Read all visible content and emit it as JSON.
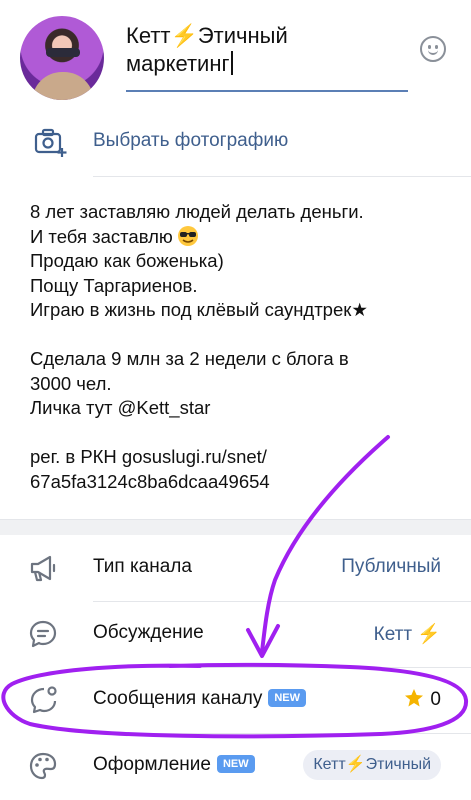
{
  "profile": {
    "name_line1": "Кетт⚡Этичный",
    "name_line2": "маркетинг",
    "emoji_icon": "smiley-icon"
  },
  "photo": {
    "label": "Выбрать фотографию",
    "icon": "camera-add-icon"
  },
  "bio": {
    "lines": [
      "8 лет заставляю людей делать деньги.",
      "И тебя заставлю",
      "Продаю как боженька)",
      "Пощу Таргариенов.",
      "Играю в жизнь под клёвый саундтрек★",
      "",
      "Сделала 9 млн за 2 недели с блога в",
      "3000 чел.",
      "Личка тут @Kett_star",
      "",
      "рег. в РКН gosuslugi.ru/snet/",
      "67a5fa3124c8ba6dcaa49654"
    ]
  },
  "settings": {
    "channel_type": {
      "label": "Тип канала",
      "value": "Публичный",
      "icon": "megaphone-icon"
    },
    "discussion": {
      "label": "Обсуждение",
      "value": "Кетт ⚡",
      "icon": "chat-bubble-icon"
    },
    "messages": {
      "label": "Сообщения каналу",
      "badge": "NEW",
      "value": "0",
      "icon": "message-dot-icon"
    },
    "design": {
      "label": "Оформление",
      "badge": "NEW",
      "value": "Кетт⚡Этичный",
      "icon": "palette-icon"
    }
  },
  "colors": {
    "accent": "#3f5f8d",
    "badge": "#5a9bf0",
    "annotation": "#a020f0",
    "underline": "#5b7fb5"
  }
}
